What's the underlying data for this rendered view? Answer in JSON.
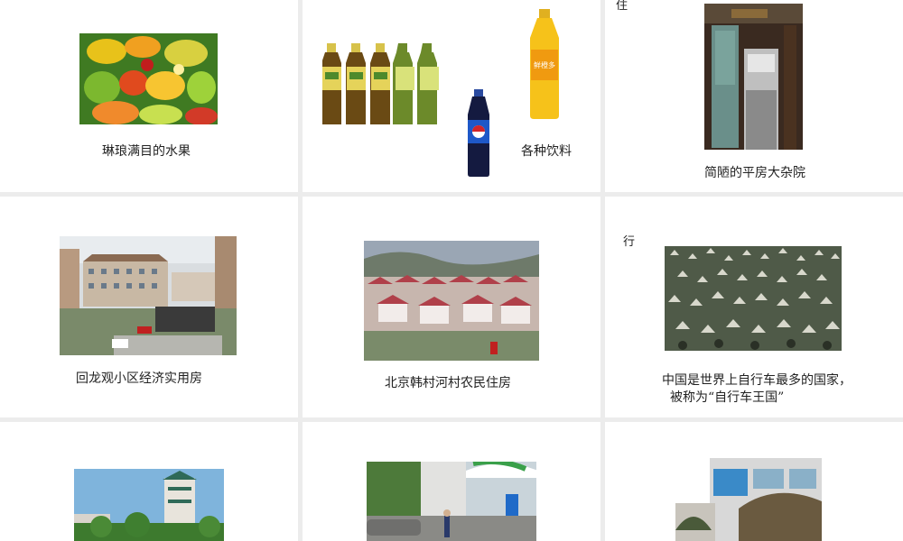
{
  "slides": [
    {
      "caption": "琳琅满目的水果"
    },
    {
      "caption": "各种饮料",
      "bottle_label": "鲜橙多"
    },
    {
      "tag": "住",
      "caption": "简陋的平房大杂院"
    },
    {
      "caption": "回龙观小区经济实用房"
    },
    {
      "caption": "北京韩村河村农民住房"
    },
    {
      "tag": "行",
      "caption_line1": "中国是世界上自行车最多的国家，",
      "caption_line2": "被称为“自行车王国”"
    },
    {},
    {},
    {}
  ]
}
